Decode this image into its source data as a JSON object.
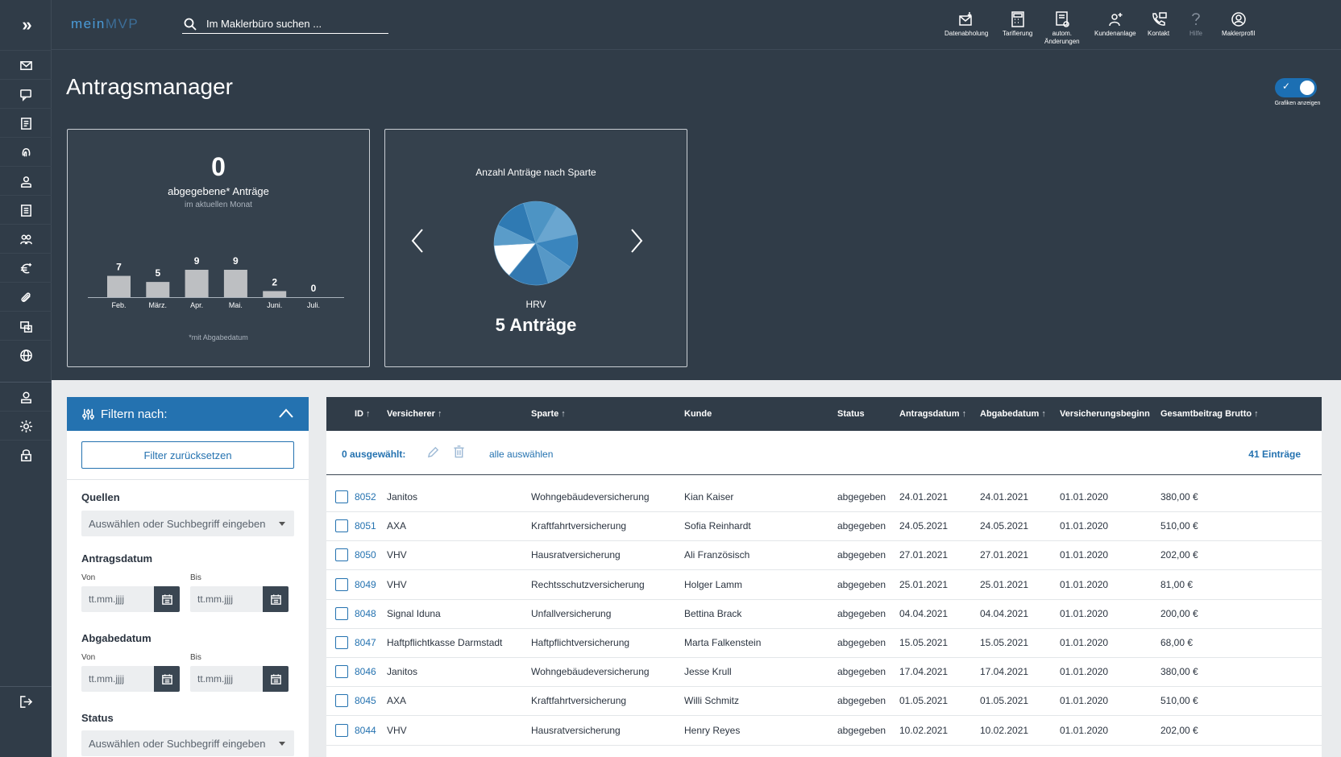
{
  "sidebar": {
    "toggle_glyph": "»",
    "items": [
      "mail-icon",
      "chat-icon",
      "document-icon",
      "fingerprint-icon",
      "person-icon",
      "list-icon",
      "group-icon",
      "euro-icon",
      "paperclip-icon",
      "transfer-icon",
      "globe-icon",
      "user-icon",
      "gear-icon",
      "lock-icon",
      "logout-icon"
    ]
  },
  "topbar": {
    "logo_prefix": "mein",
    "logo_suffix": "MVP",
    "search_placeholder": "Im Maklerbüro suchen ...",
    "actions": [
      {
        "label": "Datenabholung",
        "icon": "download-mail-icon"
      },
      {
        "label": "Tarifierung",
        "icon": "calculator-icon"
      },
      {
        "label": "autom.\nÄnderungen",
        "icon": "auto-change-icon"
      },
      {
        "label": "Kundenanlage",
        "icon": "add-customer-icon"
      },
      {
        "label": "Kontakt",
        "icon": "phone-icon"
      },
      {
        "label": "Hilfe",
        "icon": "help-icon"
      },
      {
        "label": "Maklerprofil",
        "icon": "profile-icon"
      }
    ]
  },
  "page": {
    "title": "Antragsmanager",
    "toggle_label": "Grafiken anzeigen",
    "toggle_on": true
  },
  "card1": {
    "count": "0",
    "label": "abgegebene* Anträge",
    "sublabel": "im aktuellen Monat",
    "footnote": "*mit Abgabedatum"
  },
  "card2": {
    "title": "Anzahl Anträge nach Sparte",
    "segment": "HRV",
    "segment_count": "5 Anträge"
  },
  "chart_data": [
    {
      "type": "bar",
      "categories": [
        "Feb.",
        "März.",
        "Apr.",
        "Mai.",
        "Juni.",
        "Juli."
      ],
      "values": [
        7,
        5,
        9,
        9,
        2,
        0
      ],
      "ylim": [
        0,
        9
      ],
      "color": "#bdbfc2"
    },
    {
      "type": "pie",
      "title": "Anzahl Anträge nach Sparte",
      "categories": [
        "HRV",
        "",
        "",
        "",
        "",
        "",
        "",
        ""
      ],
      "values": [
        5,
        3,
        5,
        5,
        5,
        5,
        4,
        6
      ],
      "colors": [
        "#ffffff",
        "#5a9cc9",
        "#2f7ab3",
        "#4d94c4",
        "#6aa6d0",
        "#3a85bd",
        "#5698c7",
        "#3278b0"
      ]
    }
  ],
  "filter": {
    "title": "Filtern nach:",
    "reset": "Filter zurücksetzen",
    "sources_label": "Quellen",
    "sources_placeholder": "Auswählen oder Suchbegriff eingeben",
    "antragsdatum_label": "Antragsdatum",
    "abgabedatum_label": "Abgabedatum",
    "from": "Von",
    "to": "Bis",
    "date_placeholder": "tt.mm.jjjj",
    "status_label": "Status",
    "status_placeholder": "Auswählen oder Suchbegriff eingeben"
  },
  "table": {
    "selected": "0  ausgewählt:",
    "select_all": "alle auswählen",
    "total": "41 Einträge",
    "columns": [
      {
        "label": "ID",
        "sort": true
      },
      {
        "label": "Versicherer",
        "sort": true
      },
      {
        "label": "Sparte",
        "sort": true
      },
      {
        "label": "Kunde",
        "sort": false
      },
      {
        "label": "Status",
        "sort": false
      },
      {
        "label": "Antragsdatum",
        "sort": true
      },
      {
        "label": "Abgabedatum",
        "sort": true
      },
      {
        "label": "Versicherungsbeginn",
        "sort": false
      },
      {
        "label": "Gesamtbeitrag Brutto",
        "sort": true
      }
    ],
    "rows": [
      [
        "8052",
        "Janitos",
        "Wohngebäudeversicherung",
        "Kian Kaiser",
        "abgegeben",
        "24.01.2021",
        "24.01.2021",
        "01.01.2020",
        "380,00 €"
      ],
      [
        "8051",
        "AXA",
        "Kraftfahrtversicherung",
        "Sofia Reinhardt",
        "abgegeben",
        "24.05.2021",
        "24.05.2021",
        "01.01.2020",
        "510,00 €"
      ],
      [
        "8050",
        "VHV",
        "Hausratversicherung",
        "Ali Französisch",
        "abgegeben",
        "27.01.2021",
        "27.01.2021",
        "01.01.2020",
        "202,00 €"
      ],
      [
        "8049",
        "VHV",
        "Rechtsschutzversicherung",
        "Holger Lamm",
        "abgegeben",
        "25.01.2021",
        "25.01.2021",
        "01.01.2020",
        "81,00 €"
      ],
      [
        "8048",
        "Signal Iduna",
        "Unfallversicherung",
        "Bettina Brack",
        "abgegeben",
        "04.04.2021",
        "04.04.2021",
        "01.01.2020",
        "200,00 €"
      ],
      [
        "8047",
        "Haftpflichtkasse Darmstadt",
        "Haftpflichtversicherung",
        "Marta Falkenstein",
        "abgegeben",
        "15.05.2021",
        "15.05.2021",
        "01.01.2020",
        "68,00 €"
      ],
      [
        "8046",
        "Janitos",
        "Wohngebäudeversicherung",
        "Jesse Krull",
        "abgegeben",
        "17.04.2021",
        "17.04.2021",
        "01.01.2020",
        "380,00 €"
      ],
      [
        "8045",
        "AXA",
        "Kraftfahrtversicherung",
        "Willi Schmitz",
        "abgegeben",
        "01.05.2021",
        "01.05.2021",
        "01.01.2020",
        "510,00 €"
      ],
      [
        "8044",
        "VHV",
        "Hausratversicherung",
        "Henry Reyes",
        "abgegeben",
        "10.02.2021",
        "10.02.2021",
        "01.01.2020",
        "202,00 €"
      ]
    ]
  }
}
